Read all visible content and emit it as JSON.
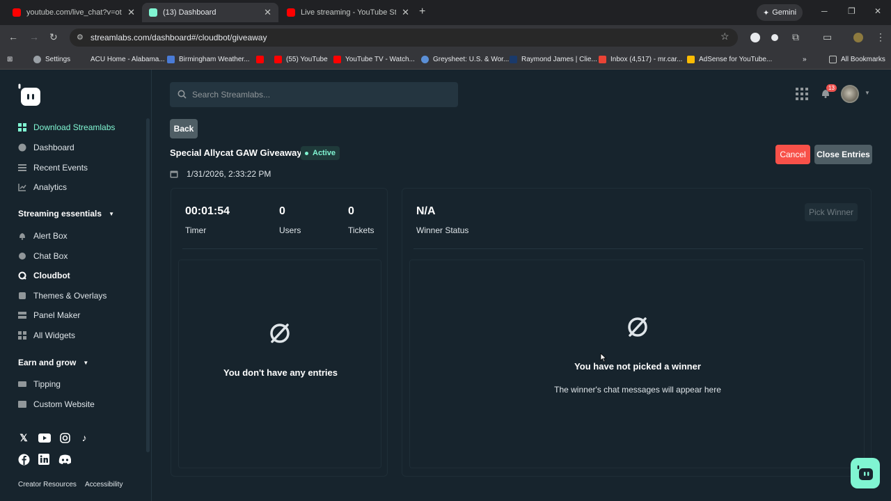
{
  "browser": {
    "tabs": [
      {
        "title": "youtube.com/live_chat?v=otuLQu",
        "favicon_color": "#ff0000"
      },
      {
        "title": "(13) Dashboard",
        "favicon_color": "#80f5d2"
      },
      {
        "title": "Live streaming - YouTube Studio",
        "favicon_color": "#ff0000"
      }
    ],
    "gemini_label": "Gemini",
    "url": "streamlabs.com/dashboard#/cloudbot/giveaway",
    "bookmarks": [
      "Settings",
      "ACU Home - Alabama...",
      "Birmingham Weather...",
      "(55) YouTube",
      "YouTube TV - Watch...",
      "Greysheet: U.S. & Wor...",
      "Raymond James | Clie...",
      "Inbox (4,517) - mr.car...",
      "AdSense for YouTube..."
    ],
    "all_bookmarks": "All Bookmarks"
  },
  "search": {
    "placeholder": "Search Streamlabs..."
  },
  "notifications": {
    "count": "13"
  },
  "sidebar": {
    "download": "Download Streamlabs",
    "dashboard": "Dashboard",
    "recent_events": "Recent Events",
    "analytics": "Analytics",
    "section1": "Streaming essentials",
    "alert_box": "Alert Box",
    "chat_box": "Chat Box",
    "cloudbot": "Cloudbot",
    "themes": "Themes & Overlays",
    "panel_maker": "Panel Maker",
    "all_widgets": "All Widgets",
    "section2": "Earn and grow",
    "tipping": "Tipping",
    "custom_website": "Custom Website",
    "creator_resources": "Creator Resources",
    "accessibility": "Accessibility"
  },
  "giveaway": {
    "back": "Back",
    "title": "Special Allycat GAW Giveaway",
    "status": "Active",
    "date": "1/31/2026, 2:33:22 PM",
    "cancel": "Cancel",
    "close_entries": "Close Entries",
    "timer_value": "00:01:54",
    "timer_label": "Timer",
    "users_value": "0",
    "users_label": "Users",
    "tickets_value": "0",
    "tickets_label": "Tickets",
    "winner_value": "N/A",
    "winner_label": "Winner Status",
    "pick_winner": "Pick Winner",
    "no_entries": "You don't have any entries",
    "no_winner": "You have not picked a winner",
    "winner_hint": "The winner's chat messages will appear here"
  },
  "colors": {
    "accent": "#80f5d2",
    "danger": "#f85149",
    "background": "#17242d"
  }
}
